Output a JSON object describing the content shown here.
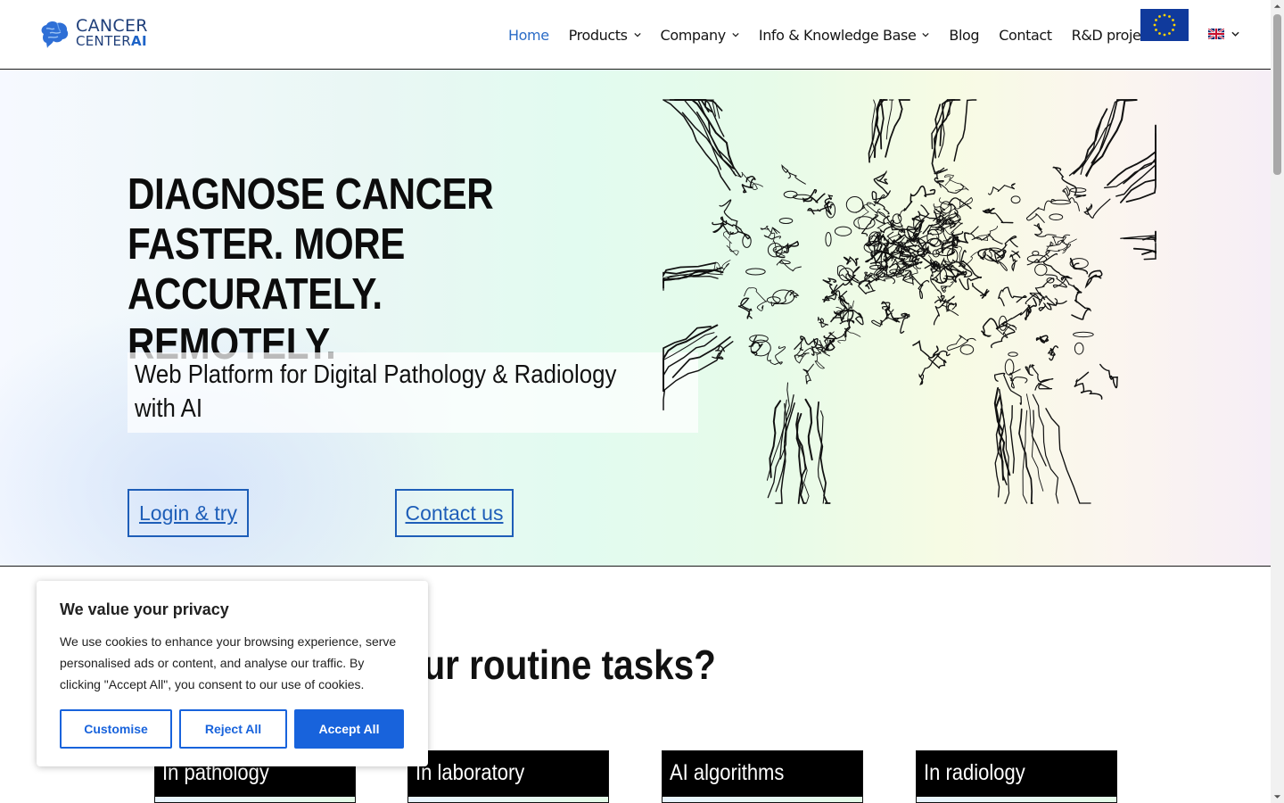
{
  "brand": {
    "logo_line1": "CANCER",
    "logo_line2_main": "CENTER",
    "logo_line2_accent": "AI",
    "logo_icon": "brain-icon"
  },
  "nav": {
    "items": [
      {
        "label": "Home",
        "active": true,
        "has_dropdown": false
      },
      {
        "label": "Products",
        "active": false,
        "has_dropdown": true
      },
      {
        "label": "Company",
        "active": false,
        "has_dropdown": true
      },
      {
        "label": "Info & Knowledge Base",
        "active": false,
        "has_dropdown": true
      },
      {
        "label": "Blog",
        "active": false,
        "has_dropdown": false
      },
      {
        "label": "Contact",
        "active": false,
        "has_dropdown": false
      },
      {
        "label": "R&D projects",
        "active": false,
        "has_dropdown": false
      }
    ],
    "eu_flag_icon": "eu-flag-icon",
    "language_icon": "uk-flag-icon"
  },
  "hero": {
    "title_line1": "DIAGNOSE CANCER",
    "title_line2": "FASTER. MORE",
    "title_line3": "ACCURATELY. REMOTELY.",
    "subtitle": "Web Platform for Digital Pathology & Radiology with AI",
    "login_button": "Login & try",
    "contact_button": "Contact us",
    "illustration": "cancer-cell-illustration"
  },
  "section": {
    "title_visible": "your routine tasks?",
    "cards": [
      {
        "label": "In pathology"
      },
      {
        "label": "In laboratory"
      },
      {
        "label": "AI algorithms"
      },
      {
        "label": "In radiology"
      }
    ]
  },
  "cookie_banner": {
    "title": "We value your privacy",
    "text": "We use cookies to enhance your browsing experience, serve personalised ads or content, and analyse our traffic. By clicking \"Accept All\", you consent to our use of cookies.",
    "customise": "Customise",
    "reject": "Reject All",
    "accept": "Accept All"
  },
  "colors": {
    "accent": "#1e5eb8",
    "nav_active": "#2b6cc7",
    "cookie_accent": "#1863dc",
    "logo_navy": "#1f3f7a"
  }
}
